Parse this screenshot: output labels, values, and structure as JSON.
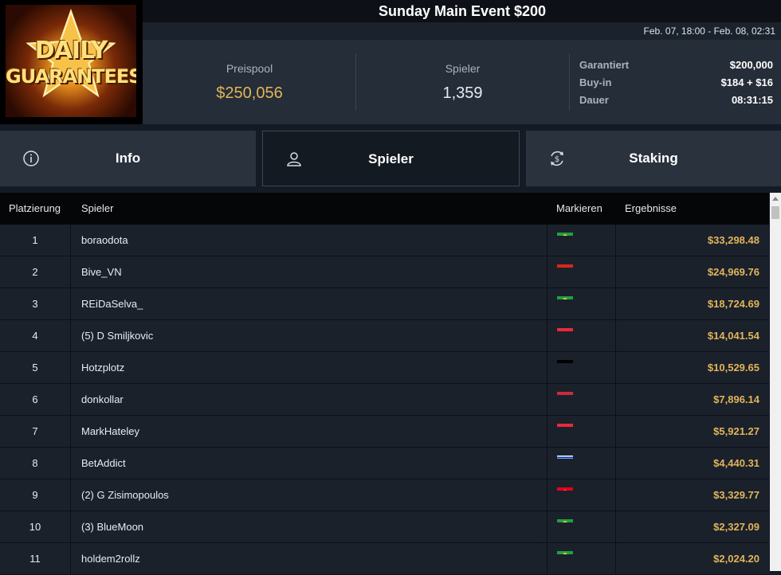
{
  "header": {
    "title": "Sunday Main Event $200",
    "dates": "Feb. 07, 18:00 - Feb. 08, 02:31",
    "logo_line1": "DAILY",
    "logo_line2": "GUARANTEES"
  },
  "stats": {
    "prizepool_label": "Preispool",
    "prizepool_value": "$250,056",
    "players_label": "Spieler",
    "players_value": "1,359",
    "guaranteed_label": "Garantiert",
    "guaranteed_value": "$200,000",
    "buyin_label": "Buy-in",
    "buyin_value": "$184 + $16",
    "duration_label": "Dauer",
    "duration_value": "08:31:15"
  },
  "tabs": [
    {
      "label": "Info",
      "icon": "info-icon",
      "active": false
    },
    {
      "label": "Spieler",
      "icon": "user-icon",
      "active": true
    },
    {
      "label": "Staking",
      "icon": "dollar-cycle-icon",
      "active": false
    }
  ],
  "table": {
    "columns": [
      "Platzierung",
      "Spieler",
      "Markieren",
      "Ergebnisse"
    ],
    "rows": [
      {
        "place": "1",
        "player": "boraodota",
        "flag": "brazil",
        "result": "$33,298.48"
      },
      {
        "place": "2",
        "player": "Bive_VN",
        "flag": "vietnam",
        "result": "$24,969.76"
      },
      {
        "place": "3",
        "player": "REiDaSelva_",
        "flag": "brazil",
        "result": "$18,724.69"
      },
      {
        "place": "4",
        "player": "(5) D Smiljkovic",
        "flag": "austria",
        "result": "$14,041.54"
      },
      {
        "place": "5",
        "player": "Hotzplotz",
        "flag": "germany",
        "result": "$10,529.65"
      },
      {
        "place": "6",
        "player": "donkollar",
        "flag": "hungary",
        "result": "$7,896.14"
      },
      {
        "place": "7",
        "player": "MarkHateley",
        "flag": "austria",
        "result": "$5,921.27"
      },
      {
        "place": "8",
        "player": "BetAddict",
        "flag": "israel",
        "result": "$4,440.31"
      },
      {
        "place": "9",
        "player": "(2) G Zisimopoulos",
        "flag": "tunisia",
        "result": "$3,329.77"
      },
      {
        "place": "10",
        "player": "(3) BlueMoon",
        "flag": "brazil",
        "result": "$2,327.09"
      },
      {
        "place": "11",
        "player": "holdem2rollz",
        "flag": "brazil",
        "result": "$2,024.20"
      }
    ]
  },
  "colors": {
    "accent_gold": "#e3b45a",
    "background": "#151b24"
  }
}
